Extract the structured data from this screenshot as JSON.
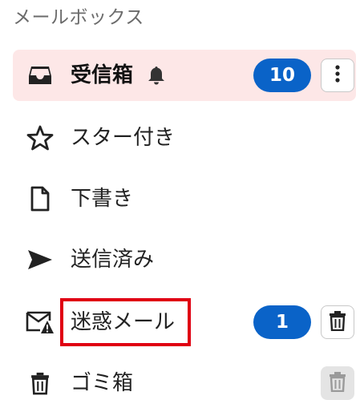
{
  "section": {
    "title": "メールボックス"
  },
  "folders": [
    {
      "label": "受信箱",
      "icon": "inbox-icon",
      "badge": "10",
      "selected": true,
      "extra_icon": "bell-icon",
      "action_icon": "more-vertical-icon"
    },
    {
      "label": "スター付き",
      "icon": "star-icon"
    },
    {
      "label": "下書き",
      "icon": "document-icon"
    },
    {
      "label": "送信済み",
      "icon": "send-icon"
    },
    {
      "label": "迷惑メール",
      "icon": "spam-mail-icon",
      "badge": "1",
      "action_icon": "trash-icon"
    },
    {
      "label": "ゴミ箱",
      "icon": "trash-icon",
      "action_icon": "trash-icon",
      "action_disabled": true
    }
  ],
  "colors": {
    "selected_bg": "#fde7e7",
    "badge_bg": "#0a63c8",
    "highlight": "#e00012"
  }
}
